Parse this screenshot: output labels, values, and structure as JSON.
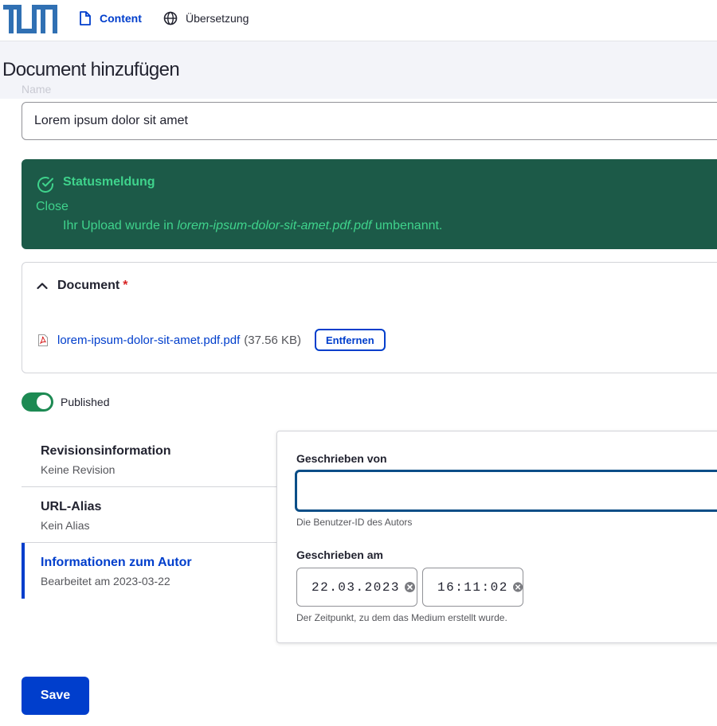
{
  "colors": {
    "accent": "#003ecc",
    "status_bg": "#1c5a48",
    "status_text": "#3fd38c",
    "toggle_on": "#1d8a53",
    "required": "#d72222"
  },
  "topbar": {
    "logo_icon": "tum-logo",
    "items": [
      {
        "label": "Content",
        "icon": "document-icon",
        "active": true
      },
      {
        "label": "Übersetzung",
        "icon": "globe-icon",
        "active": false
      }
    ]
  },
  "page": {
    "title": "Document hinzufügen"
  },
  "name_field": {
    "label": "Name",
    "value": "Lorem ipsum dolor sit amet"
  },
  "status_message": {
    "title": "Statusmeldung",
    "close_label": "Close",
    "text_before": "Ihr Upload wurde in ",
    "filename": "lorem-ipsum-dolor-sit-amet.pdf.pdf",
    "text_after": " umbenannt."
  },
  "document": {
    "label": "Document",
    "required_marker": "*",
    "file_name": "lorem-ipsum-dolor-sit-amet.pdf.pdf",
    "file_size": "(37.56 KB)",
    "remove_label": "Entfernen"
  },
  "published": {
    "label": "Published",
    "checked": true
  },
  "vertical_tabs": [
    {
      "title": "Revisionsinformation",
      "summary": "Keine Revision",
      "active": false
    },
    {
      "title": "URL-Alias",
      "summary": "Kein Alias",
      "active": false
    },
    {
      "title": "Informationen zum Autor",
      "summary": "Bearbeitet am 2023-03-22",
      "active": true
    }
  ],
  "author_panel": {
    "written_by_label": "Geschrieben von",
    "written_by_value": "",
    "written_by_desc": "Die Benutzer-ID des Autors",
    "written_on_label": "Geschrieben am",
    "date_value": "22.03.2023",
    "time_value": "16:11:02",
    "written_on_desc": "Der Zeitpunkt, zu dem das Medium erstellt wurde."
  },
  "actions": {
    "save_label": "Save"
  }
}
